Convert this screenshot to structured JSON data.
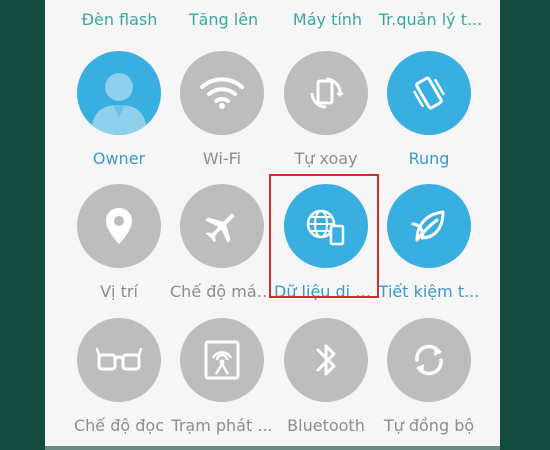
{
  "top_row": [
    {
      "label": "Đèn flash"
    },
    {
      "label": "Tăng lên"
    },
    {
      "label": "Máy tính"
    },
    {
      "label": "Tr.quản lý t..."
    }
  ],
  "tiles": [
    {
      "label": "Owner",
      "icon": "user-avatar-icon",
      "active": true
    },
    {
      "label": "Wi-Fi",
      "icon": "wifi-icon",
      "active": false
    },
    {
      "label": "Tự xoay",
      "icon": "auto-rotate-icon",
      "active": false
    },
    {
      "label": "Rung",
      "icon": "vibrate-icon",
      "active": true
    },
    {
      "label": "Vị trí",
      "icon": "location-pin-icon",
      "active": false
    },
    {
      "label": "Chế độ máy ...",
      "icon": "airplane-icon",
      "active": false
    },
    {
      "label": "Dữ liệu di độ...",
      "icon": "mobile-data-icon",
      "active": true
    },
    {
      "label": "Tiết kiệm t...",
      "icon": "leaf-icon",
      "active": true
    },
    {
      "label": "Chế độ đọc",
      "icon": "glasses-icon",
      "active": false
    },
    {
      "label": "Trạm phát ...",
      "icon": "hotspot-icon",
      "active": false
    },
    {
      "label": "Bluetooth",
      "icon": "bluetooth-icon",
      "active": false
    },
    {
      "label": "Tự đồng bộ",
      "icon": "sync-icon",
      "active": false
    }
  ],
  "colors": {
    "active_circle": "#39aee0",
    "inactive_circle": "#bdbdbd",
    "active_label": "#3a98c9",
    "inactive_label": "#8d8d8d",
    "highlight_border": "#d52b2b",
    "background": "#134b3f"
  }
}
